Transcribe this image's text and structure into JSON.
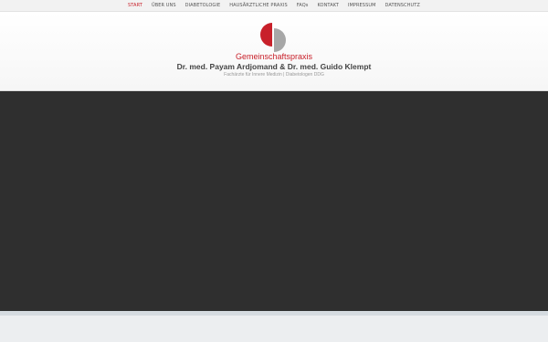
{
  "nav": {
    "items": [
      {
        "label": "START",
        "active": true
      },
      {
        "label": "ÜBER UNS",
        "active": false
      },
      {
        "label": "DIABETOLOGIE",
        "active": false
      },
      {
        "label": "HAUSÄRZTLICHE PRAXIS",
        "active": false
      },
      {
        "label": "FAQs",
        "active": false
      },
      {
        "label": "KONTAKT",
        "active": false
      },
      {
        "label": "IMPRESSUM",
        "active": false
      },
      {
        "label": "DATENSCHUTZ",
        "active": false
      }
    ]
  },
  "header": {
    "logo_icon": "split-circle-logo-icon",
    "brand_name": "Gemeinschaftspraxis",
    "doctors": "Dr. med. Payam Ardjomand & Dr. med. Guido Klempt",
    "subtitle": "Fachärzte für Innere Medizin | Diabetologen DDG"
  },
  "colors": {
    "accent_red": "#c8202a",
    "logo_gray": "#a7a7a7",
    "hero_background": "#2f2f2f",
    "nav_background": "#f2f2f2"
  }
}
